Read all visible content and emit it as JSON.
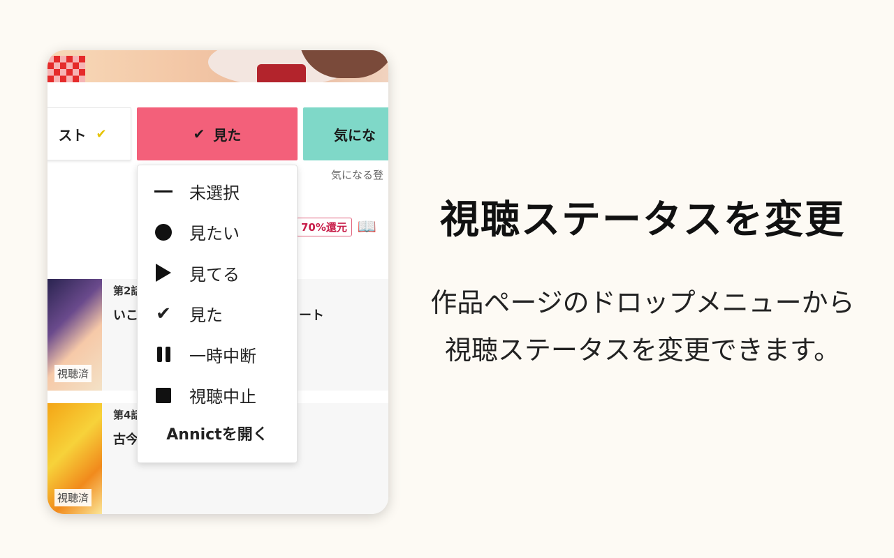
{
  "tabs": {
    "list_label": "スト",
    "watched_label": "見た",
    "interest_label": "気にな",
    "interest_note": "気になる登"
  },
  "dropdown": {
    "items": [
      {
        "label": "未選択",
        "icon": "menu-lines-icon"
      },
      {
        "label": "見たい",
        "icon": "circle-icon"
      },
      {
        "label": "見てる",
        "icon": "play-icon"
      },
      {
        "label": "見た",
        "icon": "check-icon"
      },
      {
        "label": "一時中断",
        "icon": "pause-icon"
      },
      {
        "label": "視聴中止",
        "icon": "stop-icon"
      }
    ],
    "open_label": "Annictを開く"
  },
  "promo": {
    "badge": "70%還元"
  },
  "episodes": [
    {
      "number": "第2話",
      "title": "いこ",
      "title_tail": "ート",
      "badge": "視聴済"
    },
    {
      "number": "第4話",
      "title": "古今",
      "badge": "視聴済"
    }
  ],
  "headline": "視聴ステータスを変更",
  "description_line1": "作品ページのドロップメニューから",
  "description_line2": "視聴ステータスを変更できます。",
  "colors": {
    "watched_tab": "#f3607a",
    "interest_tab": "#7fd8c8",
    "background": "#fdfaf4"
  }
}
